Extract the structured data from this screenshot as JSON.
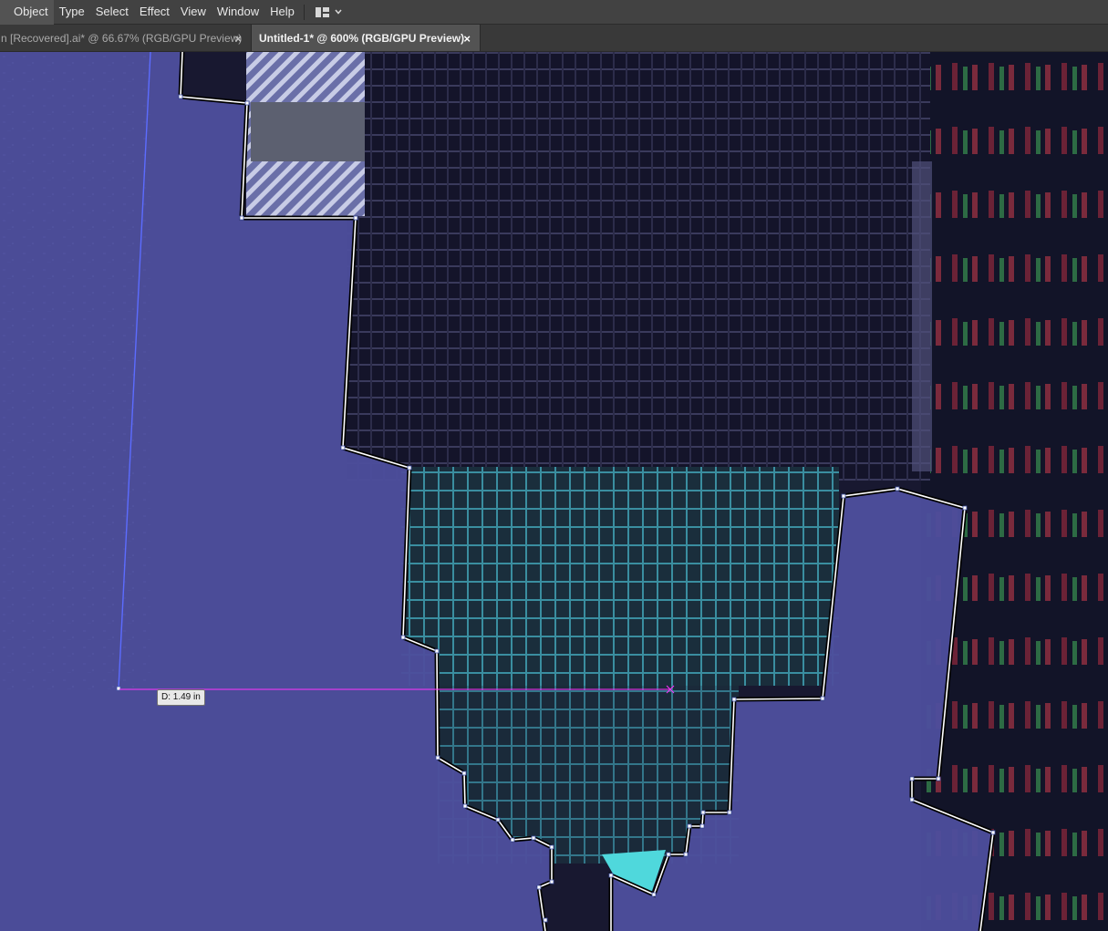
{
  "menubar": {
    "items": [
      "Object",
      "Type",
      "Select",
      "Effect",
      "View",
      "Window",
      "Help"
    ],
    "workspace_switcher_icon": "workspace-layout-icon",
    "dropdown_icon": "chevron-down-icon"
  },
  "tabs": [
    {
      "label": "n [Recovered].ai* @ 66.67% (RGB/GPU Preview)",
      "close": "×",
      "active": false
    },
    {
      "label": "Untitled-1* @ 600% (RGB/GPU Preview)",
      "close": "×",
      "active": true
    }
  ],
  "canvas": {
    "measure_readout": "D: 1.49 in",
    "colors": {
      "background_photo": "#1b1b33",
      "selection_fill": "#4d4e9c",
      "path_stroke": "#ffffff",
      "path_outline": "#000000",
      "measure_guide": "#ff33ff",
      "building_cyan": "#4fd8dc"
    }
  }
}
